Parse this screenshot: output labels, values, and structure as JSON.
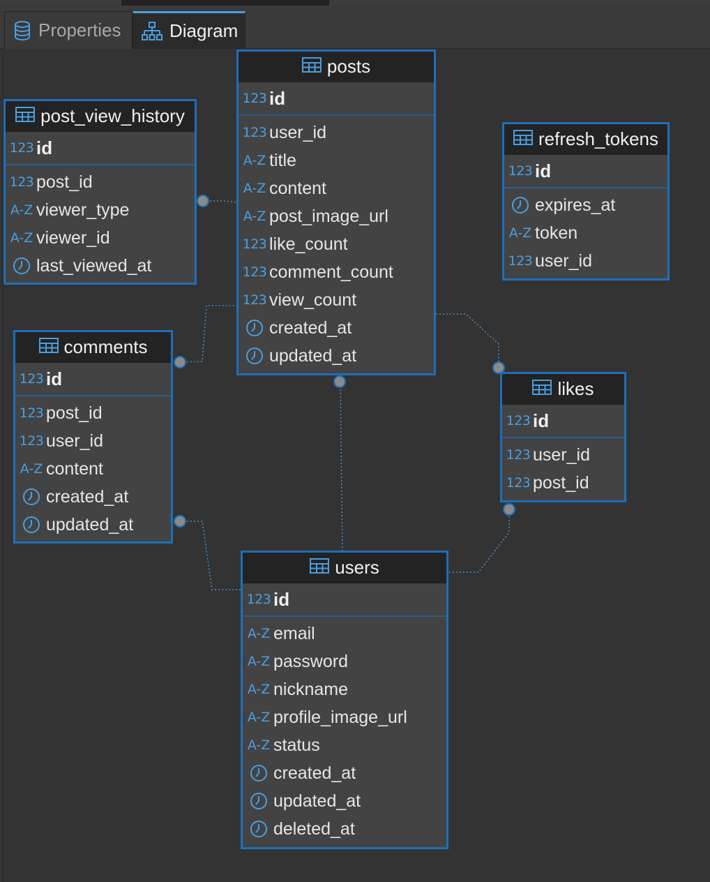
{
  "tabs": [
    {
      "label": "Properties",
      "icon": "database-icon",
      "active": false
    },
    {
      "label": "Diagram",
      "icon": "diagram-icon",
      "active": true
    }
  ],
  "type_icons": {
    "number": "123",
    "text": "A-Z",
    "datetime": "clock-icon"
  },
  "colors": {
    "accent": "#1f6fb8",
    "icon": "#4a9fe0",
    "header": "#232323",
    "body": "#434343",
    "canvas": "#333333"
  },
  "entities": {
    "posts": {
      "title": "posts",
      "pk": {
        "name": "id",
        "type": "123"
      },
      "columns": [
        {
          "name": "user_id",
          "type": "123"
        },
        {
          "name": "title",
          "type": "A-Z"
        },
        {
          "name": "content",
          "type": "A-Z"
        },
        {
          "name": "post_image_url",
          "type": "A-Z"
        },
        {
          "name": "like_count",
          "type": "123"
        },
        {
          "name": "comment_count",
          "type": "123"
        },
        {
          "name": "view_count",
          "type": "123"
        },
        {
          "name": "created_at",
          "type": "clock"
        },
        {
          "name": "updated_at",
          "type": "clock"
        }
      ]
    },
    "post_view_history": {
      "title": "post_view_history",
      "pk": {
        "name": "id",
        "type": "123"
      },
      "columns": [
        {
          "name": "post_id",
          "type": "123"
        },
        {
          "name": "viewer_type",
          "type": "A-Z"
        },
        {
          "name": "viewer_id",
          "type": "A-Z"
        },
        {
          "name": "last_viewed_at",
          "type": "clock"
        }
      ]
    },
    "refresh_tokens": {
      "title": "refresh_tokens",
      "pk": {
        "name": "id",
        "type": "123"
      },
      "columns": [
        {
          "name": "expires_at",
          "type": "clock"
        },
        {
          "name": "token",
          "type": "A-Z"
        },
        {
          "name": "user_id",
          "type": "123"
        }
      ]
    },
    "comments": {
      "title": "comments",
      "pk": {
        "name": "id",
        "type": "123"
      },
      "columns": [
        {
          "name": "post_id",
          "type": "123"
        },
        {
          "name": "user_id",
          "type": "123"
        },
        {
          "name": "content",
          "type": "A-Z"
        },
        {
          "name": "created_at",
          "type": "clock"
        },
        {
          "name": "updated_at",
          "type": "clock"
        }
      ]
    },
    "likes": {
      "title": "likes",
      "pk": {
        "name": "id",
        "type": "123"
      },
      "columns": [
        {
          "name": "user_id",
          "type": "123"
        },
        {
          "name": "post_id",
          "type": "123"
        }
      ]
    },
    "users": {
      "title": "users",
      "pk": {
        "name": "id",
        "type": "123"
      },
      "columns": [
        {
          "name": "email",
          "type": "A-Z"
        },
        {
          "name": "password",
          "type": "A-Z"
        },
        {
          "name": "nickname",
          "type": "A-Z"
        },
        {
          "name": "profile_image_url",
          "type": "A-Z"
        },
        {
          "name": "status",
          "type": "A-Z"
        },
        {
          "name": "created_at",
          "type": "clock"
        },
        {
          "name": "updated_at",
          "type": "clock"
        },
        {
          "name": "deleted_at",
          "type": "clock"
        }
      ]
    }
  }
}
